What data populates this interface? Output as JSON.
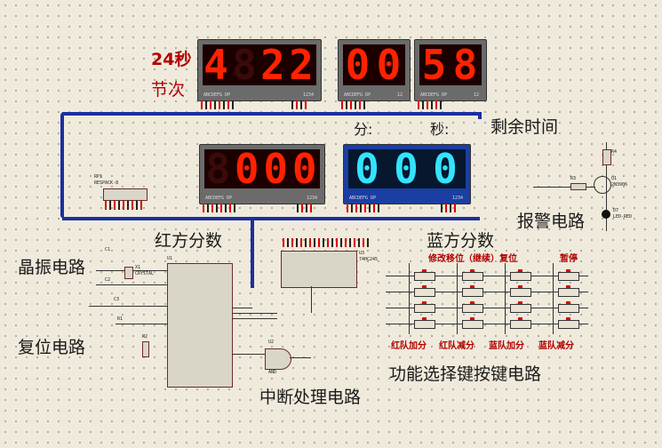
{
  "labels": {
    "shot_clock": "24秒",
    "period": "节次",
    "min": "分:",
    "sec": "秒:",
    "remaining_time": "剩余时间",
    "red_score": "红方分数",
    "blue_score": "蓝方分数",
    "alarm_circuit": "报警电路",
    "crystal_circuit": "晶振电路",
    "reset_circuit": "复位电路",
    "interrupt_circuit": "中断处理电路",
    "key_circuit": "功能选择键按键电路",
    "modify_move_reset": "修改移位（继续）复位",
    "pause": "暂停",
    "red_add": "红队加分",
    "red_sub": "红队减分",
    "blue_add": "蓝队加分",
    "blue_sub": "蓝队减分"
  },
  "displays": {
    "shot_period": [
      "4",
      "",
      "2",
      "2"
    ],
    "minutes": [
      "0",
      "0"
    ],
    "seconds": [
      "5",
      "8"
    ],
    "red": [
      "",
      "0",
      "0",
      "0"
    ],
    "blue": [
      "0",
      "0",
      "0"
    ],
    "pin_text_a": "ABCDEFG DP",
    "pin_text_b": "1234",
    "pin_text_c": "12"
  },
  "components": {
    "u1": "U1",
    "u2": "U2",
    "u3": "U3",
    "rp1": "RP1",
    "rp1_sub": "RESPACK-8",
    "c1": "C1",
    "c2": "C2",
    "c3": "C3",
    "x1": "X1",
    "x1_sub": "CRYSTAL",
    "r1": "R1",
    "r2": "R2",
    "r3": "R3",
    "r4": "R4",
    "q1": "Q1",
    "q1_sub": "2N3906",
    "d7": "D7",
    "d7_sub": "LED-RED",
    "u2_sub": "AND",
    "u3_sub": "74HC245"
  },
  "colors": {
    "bus": "#1c2fa0",
    "red_led": "#ff2200",
    "blue_led": "#33e3ff",
    "label_red": "#b30000"
  }
}
